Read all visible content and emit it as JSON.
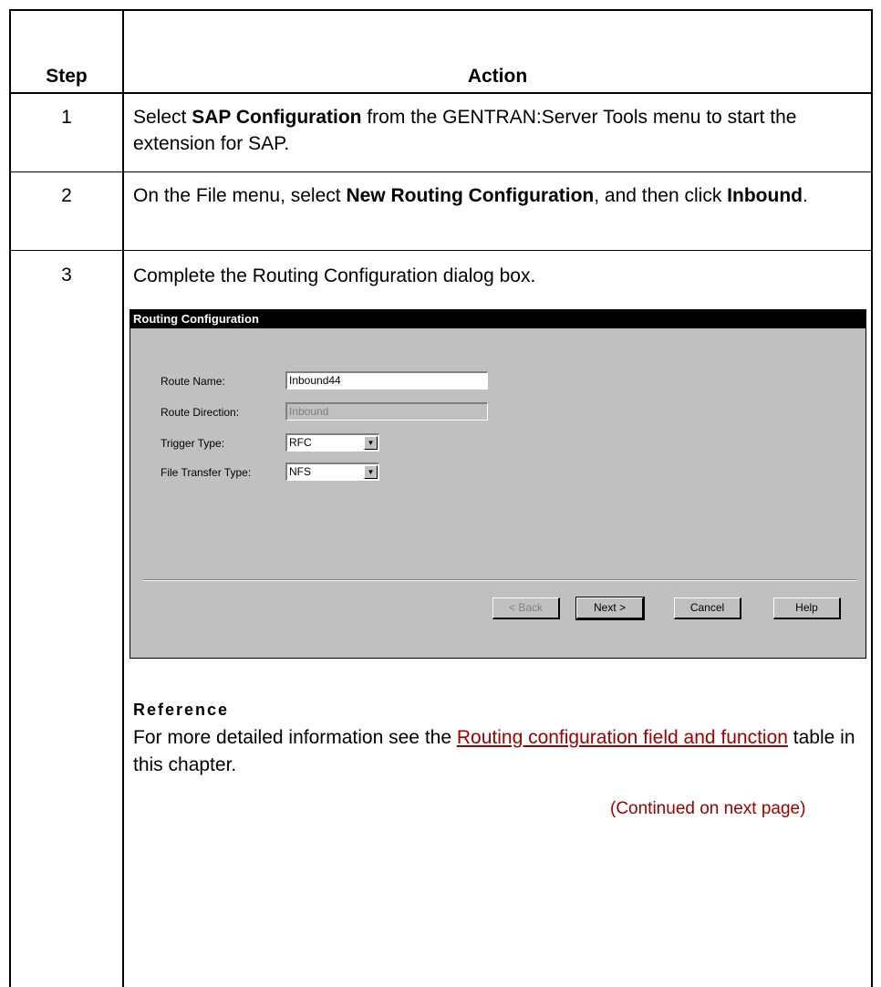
{
  "table": {
    "header_step": "Step",
    "header_action": "Action",
    "rows": [
      {
        "step": "1",
        "pre": "Select ",
        "bold1": "SAP Configuration",
        "mid": " from the GENTRAN:Server Tools menu to start the extension for SAP.",
        "bold2": "",
        "post": ""
      },
      {
        "step": "2",
        "pre": "On the File menu, select ",
        "bold1": "New Routing Configuration",
        "mid": ", and then click ",
        "bold2": "Inbound",
        "post": "."
      },
      {
        "step": "3",
        "text": "Complete the Routing Configuration dialog box."
      }
    ]
  },
  "dialog": {
    "title": "Routing Configuration",
    "route_name_label": "Route Name:",
    "route_name_value": "Inbound44",
    "route_direction_label": "Route Direction:",
    "route_direction_value": "Inbound",
    "trigger_type_label": "Trigger Type:",
    "trigger_type_value": "RFC",
    "file_transfer_label": "File Transfer Type:",
    "file_transfer_value": "NFS",
    "back_button": "< Back",
    "next_button": "Next >",
    "cancel_button": "Cancel",
    "help_button": "Help"
  },
  "reference": {
    "heading": "Reference",
    "pre": "For more detailed information see the ",
    "link": "Routing configuration field and function",
    "post": " table in this chapter."
  },
  "continued": "(Continued on next page)"
}
